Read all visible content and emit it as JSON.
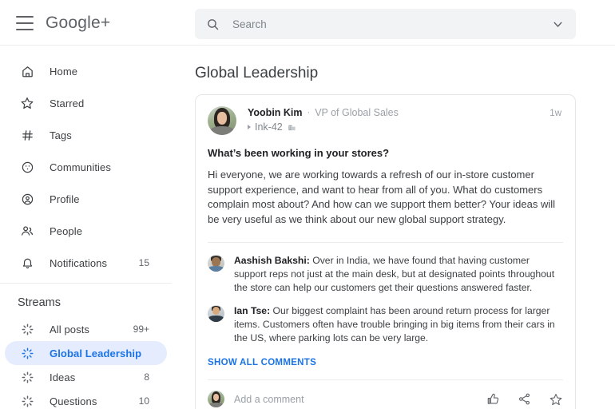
{
  "app": {
    "brand": "Google+",
    "menu_icon": "hamburger-menu-icon",
    "accent_color": "#1a73e8",
    "progress_bar_color": "#000000"
  },
  "search": {
    "placeholder": "Search",
    "value": "",
    "icon": "search-icon",
    "expand_icon": "chevron-down-icon"
  },
  "sidebar": {
    "primary": [
      {
        "label": "Home",
        "icon": "home-icon",
        "count": ""
      },
      {
        "label": "Starred",
        "icon": "star-icon",
        "count": ""
      },
      {
        "label": "Tags",
        "icon": "hash-icon",
        "count": ""
      },
      {
        "label": "Communities",
        "icon": "communities-icon",
        "count": ""
      },
      {
        "label": "Profile",
        "icon": "profile-icon",
        "count": ""
      },
      {
        "label": "People",
        "icon": "people-icon",
        "count": ""
      },
      {
        "label": "Notifications",
        "icon": "bell-icon",
        "count": "15"
      }
    ],
    "streams_title": "Streams",
    "streams": [
      {
        "label": "All posts",
        "icon": "stream-burst-icon",
        "count": "99+",
        "active": false
      },
      {
        "label": "Global Leadership",
        "icon": "stream-burst-icon",
        "count": "",
        "active": true
      },
      {
        "label": "Ideas",
        "icon": "stream-burst-icon",
        "count": "8",
        "active": false
      },
      {
        "label": "Questions",
        "icon": "stream-burst-icon",
        "count": "10",
        "active": false
      }
    ]
  },
  "main": {
    "page_title": "Global Leadership",
    "post": {
      "author_name": "Yoobin Kim",
      "separator": "·",
      "author_role": "VP of Global Sales",
      "group_name": "Ink-42",
      "group_badge_icon": "business-badge-icon",
      "timestamp": "1w",
      "title": "What’s been working in your stores?",
      "body": "Hi everyone, we are working towards a refresh of our in-store customer support experience, and want to hear from all of you. What do customers complain most about? And how can we support them better? Your ideas will be very useful as we think about our new global support strategy.",
      "comments": [
        {
          "author": "Aashish Bakshi:",
          "text": " Over in India, we have found that having customer support reps not just at the main desk, but at designated points throughout the store can help our customers get their questions answered faster.",
          "avatar": "ph-aashish"
        },
        {
          "author": "Ian Tse:",
          "text": " Our biggest complaint has been around return process for larger items. Customers often have trouble bringing in big items from their cars in the US, where parking lots can be very large.",
          "avatar": "ph-ian"
        }
      ],
      "show_all_comments": "SHOW ALL COMMENTS",
      "composer_placeholder": "Add a comment",
      "actions": [
        {
          "name": "thumbs-up-icon"
        },
        {
          "name": "share-icon"
        },
        {
          "name": "star-icon"
        }
      ]
    }
  }
}
